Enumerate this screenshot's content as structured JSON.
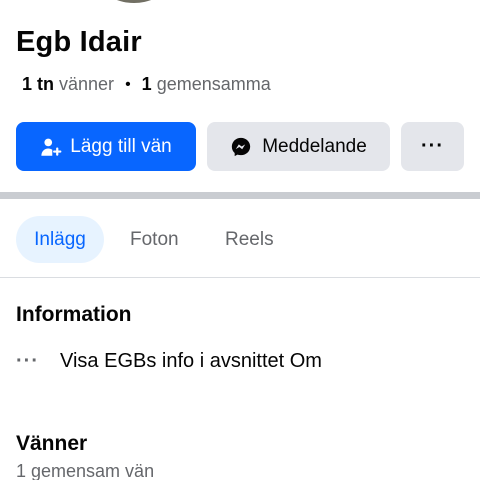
{
  "profile": {
    "name": "Egb Idair",
    "stats": {
      "friends_count": "1 tn",
      "friends_label": "vänner",
      "separator": "•",
      "mutual_count": "1",
      "mutual_label": "gemensamma"
    }
  },
  "actions": {
    "add_friend_label": "Lägg till vän",
    "message_label": "Meddelande",
    "more_label": "···"
  },
  "tabs": [
    {
      "label": "Inlägg",
      "active": true
    },
    {
      "label": "Foton",
      "active": false
    },
    {
      "label": "Reels",
      "active": false
    }
  ],
  "information": {
    "title": "Information",
    "item_icon": "···",
    "item_text": "Visa EGBs info i avsnittet Om"
  },
  "friends": {
    "title": "Vänner",
    "subtitle": "1 gemensam vän"
  },
  "colors": {
    "accent": "#0866ff",
    "secondary_button": "#e4e6eb",
    "active_tab_bg": "#e7f3ff",
    "muted_text": "#65676b"
  },
  "icons": {
    "add_friend": "person-add-icon",
    "message": "messenger-icon",
    "more": "more-icon"
  }
}
